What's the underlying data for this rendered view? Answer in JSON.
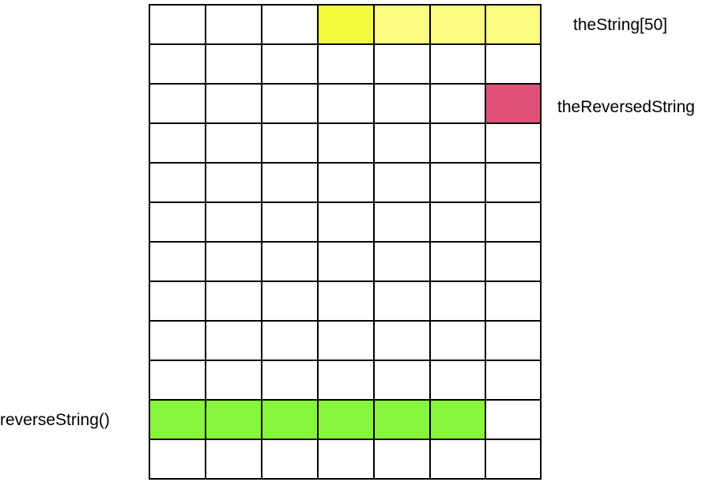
{
  "grid": {
    "rows": 12,
    "cols": 7,
    "default_color": "#ffffff",
    "highlights": [
      {
        "region": "theString",
        "row": 0,
        "col_start": 3,
        "col_end": 3,
        "color": "#f4fa3c"
      },
      {
        "region": "theString",
        "row": 0,
        "col_start": 4,
        "col_end": 6,
        "color": "#fbfb82"
      },
      {
        "region": "theReversedString",
        "row": 2,
        "col_start": 6,
        "col_end": 6,
        "color": "#e04f77"
      },
      {
        "region": "reverseString",
        "row": 10,
        "col_start": 0,
        "col_end": 5,
        "color": "#88f63c"
      }
    ]
  },
  "labels": {
    "the_string": "theString[50]",
    "the_reversed_string": "theReversedString",
    "reverse_string": "reverseString()"
  }
}
